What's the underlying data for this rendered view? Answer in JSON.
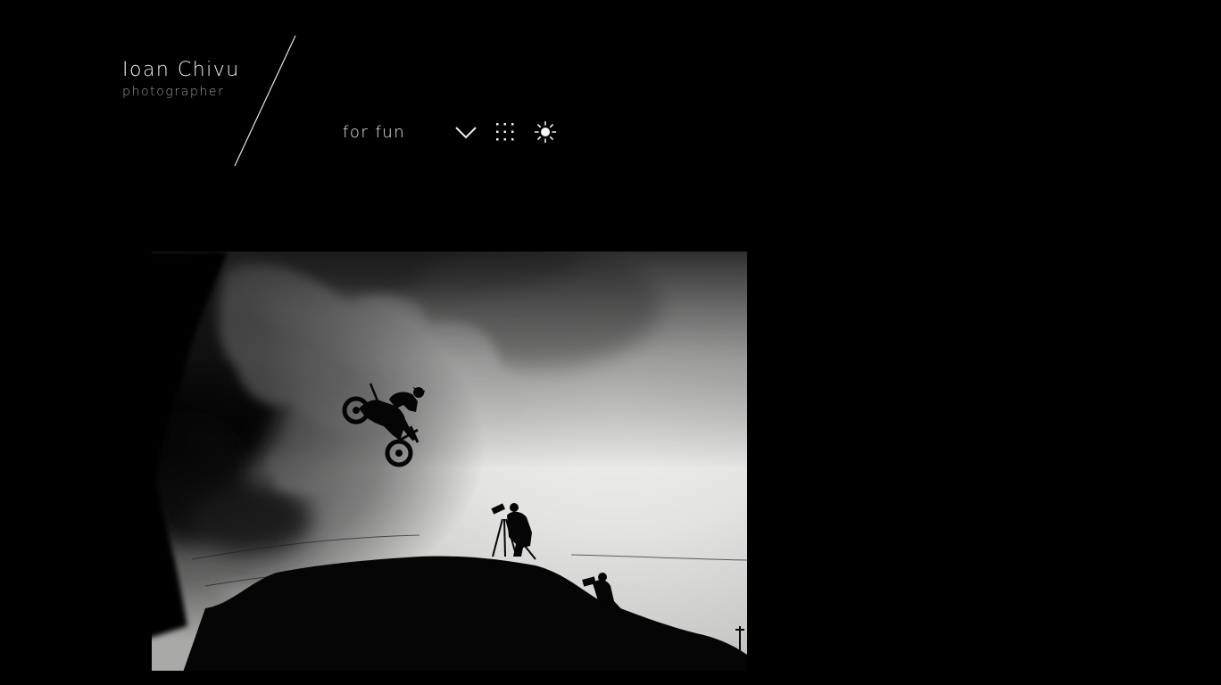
{
  "site": {
    "name": "Ioan Chivu",
    "subtitle": "photographer"
  },
  "nav": {
    "gallery_label": "for fun",
    "icons": [
      "chevron-down-icon",
      "grid-dots-icon",
      "sun-icon"
    ]
  },
  "photo": {
    "subject": "motocross-jump-silhouette",
    "tone": "black-and-white"
  },
  "colors": {
    "background": "#000000",
    "text": "#ededed",
    "muted": "#9a9a9a"
  }
}
